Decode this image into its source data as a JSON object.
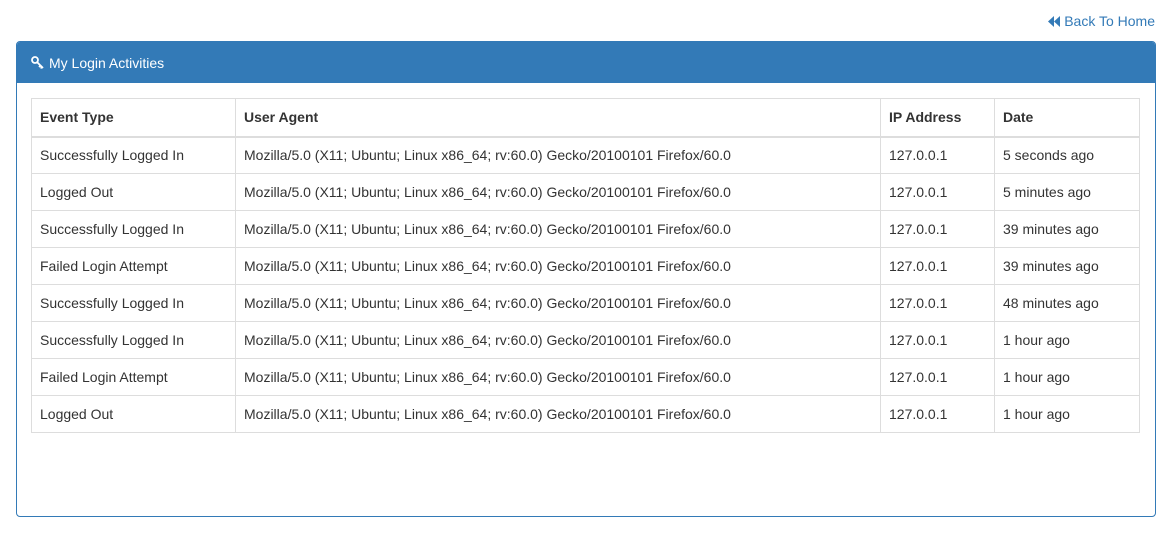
{
  "nav": {
    "back_label": "Back To Home"
  },
  "panel": {
    "title": "My Login Activities"
  },
  "table": {
    "headers": [
      "Event Type",
      "User Agent",
      "IP Address",
      "Date"
    ],
    "rows": [
      [
        "Successfully Logged In",
        "Mozilla/5.0 (X11; Ubuntu; Linux x86_64; rv:60.0) Gecko/20100101 Firefox/60.0",
        "127.0.0.1",
        "5 seconds ago"
      ],
      [
        "Logged Out",
        "Mozilla/5.0 (X11; Ubuntu; Linux x86_64; rv:60.0) Gecko/20100101 Firefox/60.0",
        "127.0.0.1",
        "5 minutes ago"
      ],
      [
        "Successfully Logged In",
        "Mozilla/5.0 (X11; Ubuntu; Linux x86_64; rv:60.0) Gecko/20100101 Firefox/60.0",
        "127.0.0.1",
        "39 minutes ago"
      ],
      [
        "Failed Login Attempt",
        "Mozilla/5.0 (X11; Ubuntu; Linux x86_64; rv:60.0) Gecko/20100101 Firefox/60.0",
        "127.0.0.1",
        "39 minutes ago"
      ],
      [
        "Successfully Logged In",
        "Mozilla/5.0 (X11; Ubuntu; Linux x86_64; rv:60.0) Gecko/20100101 Firefox/60.0",
        "127.0.0.1",
        "48 minutes ago"
      ],
      [
        "Successfully Logged In",
        "Mozilla/5.0 (X11; Ubuntu; Linux x86_64; rv:60.0) Gecko/20100101 Firefox/60.0",
        "127.0.0.1",
        "1 hour ago"
      ],
      [
        "Failed Login Attempt",
        "Mozilla/5.0 (X11; Ubuntu; Linux x86_64; rv:60.0) Gecko/20100101 Firefox/60.0",
        "127.0.0.1",
        "1 hour ago"
      ],
      [
        "Logged Out",
        "Mozilla/5.0 (X11; Ubuntu; Linux x86_64; rv:60.0) Gecko/20100101 Firefox/60.0",
        "127.0.0.1",
        "1 hour ago"
      ]
    ]
  },
  "icons": {
    "back": "backward-icon",
    "panel": "key-icon"
  },
  "colors": {
    "primary": "#337ab7",
    "border": "#dddddd",
    "text": "#333333"
  }
}
